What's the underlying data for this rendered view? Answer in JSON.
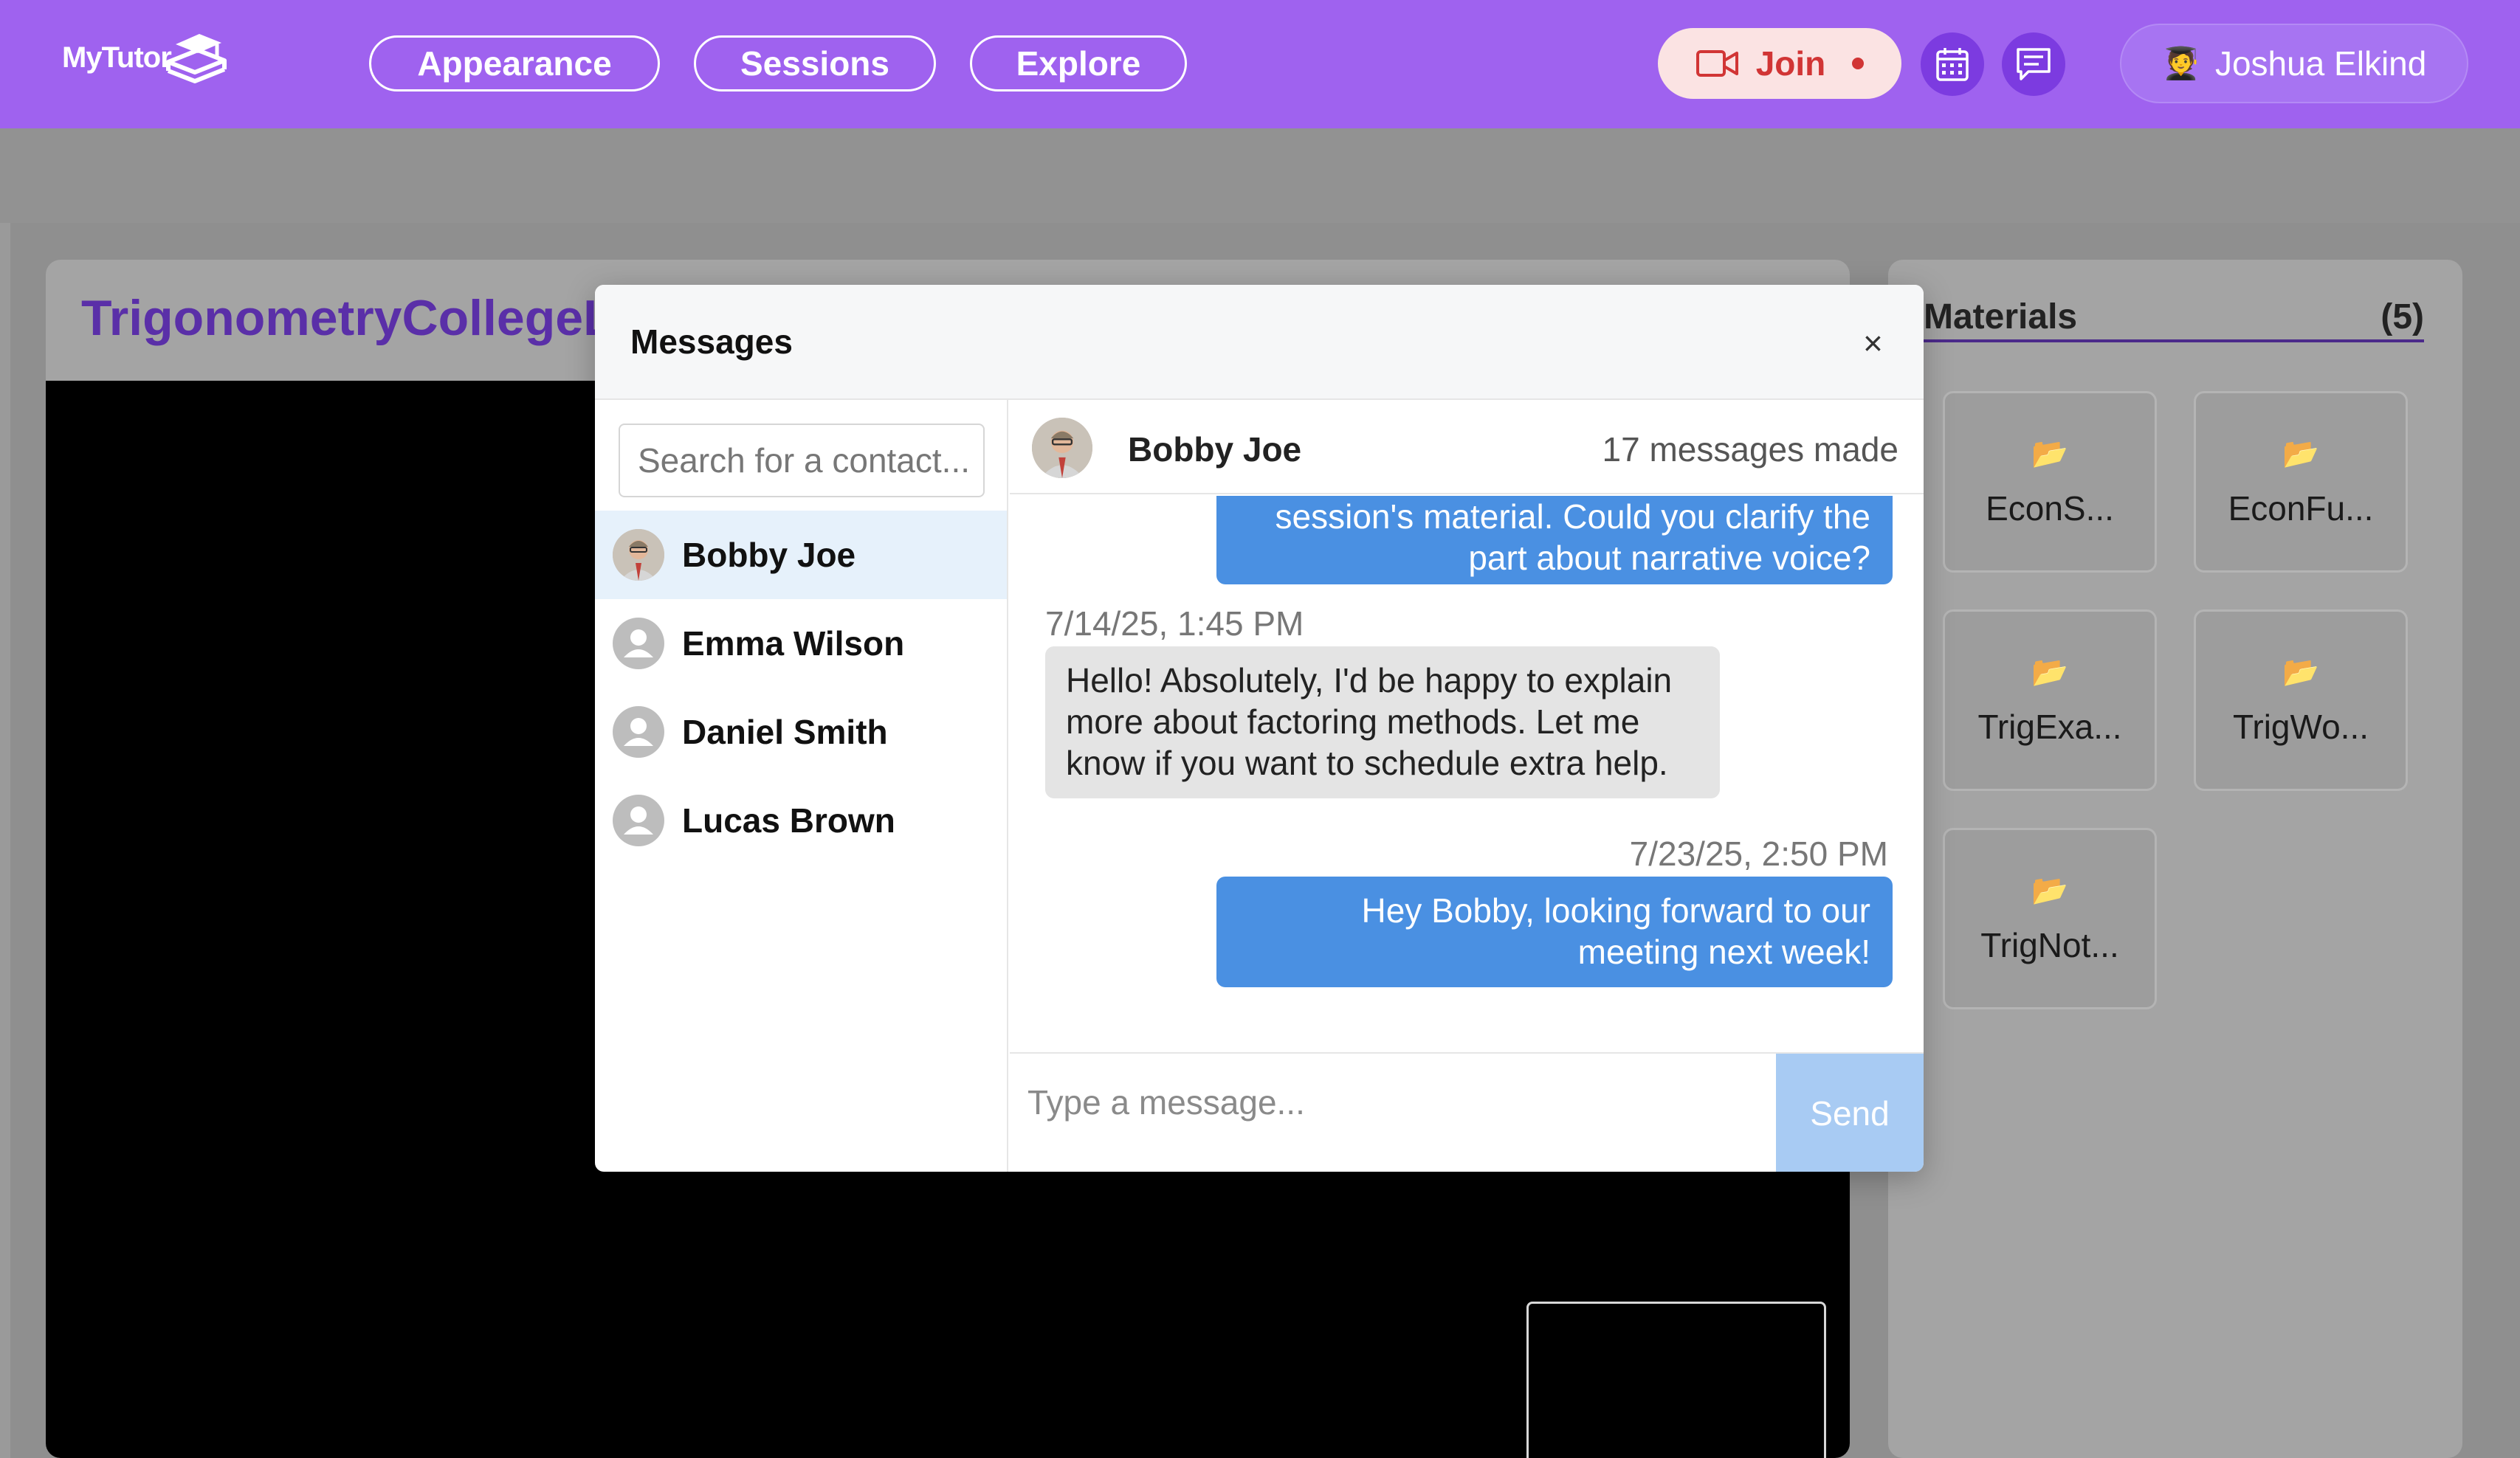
{
  "brand": {
    "name": "MyTutor"
  },
  "nav": {
    "items": [
      {
        "label": "Appearance"
      },
      {
        "label": "Sessions"
      },
      {
        "label": "Explore"
      }
    ],
    "join_label": "Join",
    "calendar_icon": "calendar-icon",
    "messages_icon": "chat-icon",
    "user_name": "Joshua Elkind",
    "user_icon": "graduate-emoji"
  },
  "course": {
    "title": "TrigonometryCollegeL"
  },
  "materials": {
    "title": "Materials",
    "count": "(5)",
    "items": [
      {
        "name": "EconS..."
      },
      {
        "name": "EconFu..."
      },
      {
        "name": "TrigExa..."
      },
      {
        "name": "TrigWo..."
      },
      {
        "name": "TrigNot..."
      }
    ]
  },
  "modal": {
    "title": "Messages",
    "close": "×",
    "search_placeholder": "Search for a contact...",
    "contacts": [
      {
        "name": "Bobby Joe",
        "active": true
      },
      {
        "name": "Emma Wilson"
      },
      {
        "name": "Daniel Smith"
      },
      {
        "name": "Lucas Brown"
      }
    ],
    "chat": {
      "contact_name": "Bobby Joe",
      "message_count": "17 messages made",
      "messages": [
        {
          "dir": "out",
          "lines": [
            "session's material. Could you clarify the",
            "part about narrative voice?"
          ]
        },
        {
          "dir": "in",
          "timestamp": "7/14/25, 1:45 PM",
          "lines": [
            "Hello! Absolutely, I'd be happy to explain",
            "more about factoring methods. Let me",
            "know if you want to schedule extra help."
          ]
        },
        {
          "dir": "out",
          "timestamp": "7/23/25, 2:50 PM",
          "lines": [
            "Hey Bobby, looking forward to our",
            "meeting next week!"
          ]
        }
      ]
    },
    "compose_placeholder": "Type a message...",
    "send_label": "Send"
  },
  "colors": {
    "topbar": "#9f62ef",
    "accent_purple": "#7c3be0",
    "outgoing_bubble": "#4a90e2",
    "incoming_bubble": "#e4e4e4",
    "join_text": "#d13535",
    "send_disabled": "#a8cbf3"
  }
}
